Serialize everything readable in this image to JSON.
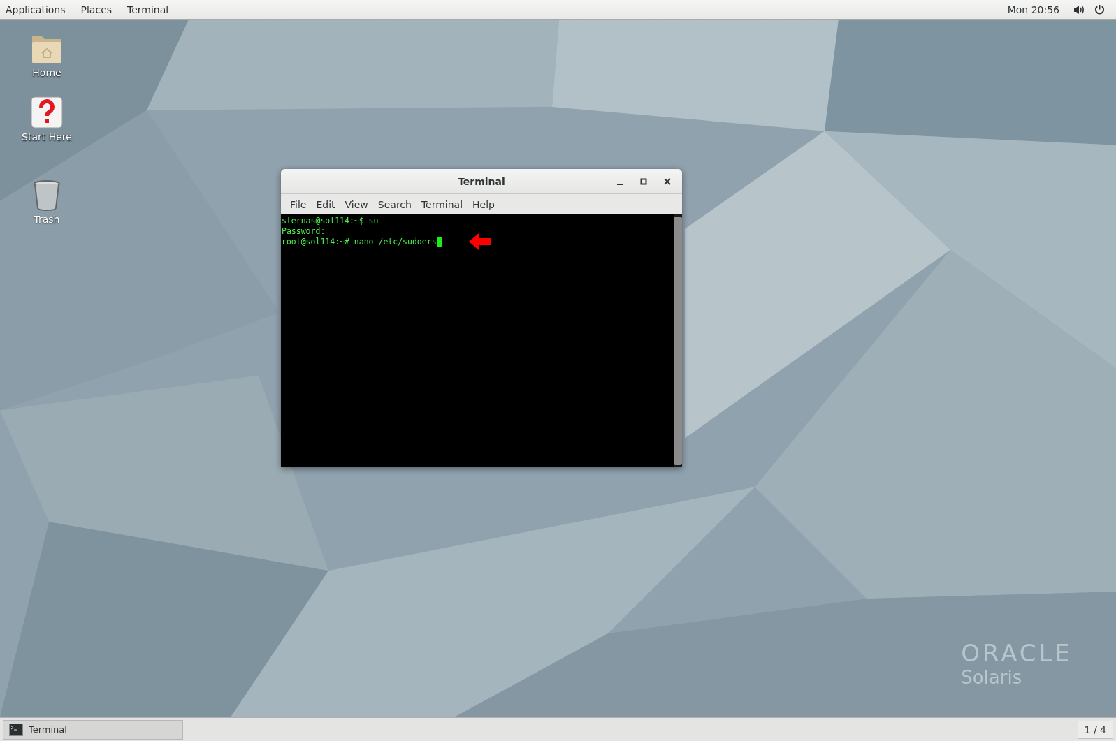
{
  "top_bar": {
    "menus": [
      "Applications",
      "Places",
      "Terminal"
    ],
    "clock": "Mon 20:56"
  },
  "desktop_icons": [
    {
      "kind": "folder",
      "label": "Home"
    },
    {
      "kind": "help",
      "label": "Start Here"
    },
    {
      "kind": "trash",
      "label": "Trash"
    }
  ],
  "terminal_window": {
    "title": "Terminal",
    "menus": [
      "File",
      "Edit",
      "View",
      "Search",
      "Terminal",
      "Help"
    ],
    "lines": [
      "sternas@sol114:~$ su",
      "Password:",
      "root@sol114:~# nano /etc/sudoers"
    ]
  },
  "wallpaper_logo": {
    "brand": "ORACLE",
    "product": "Solaris"
  },
  "taskbar": {
    "items": [
      {
        "label": "Terminal",
        "selected": true
      }
    ],
    "workspace": "1 / 4"
  }
}
